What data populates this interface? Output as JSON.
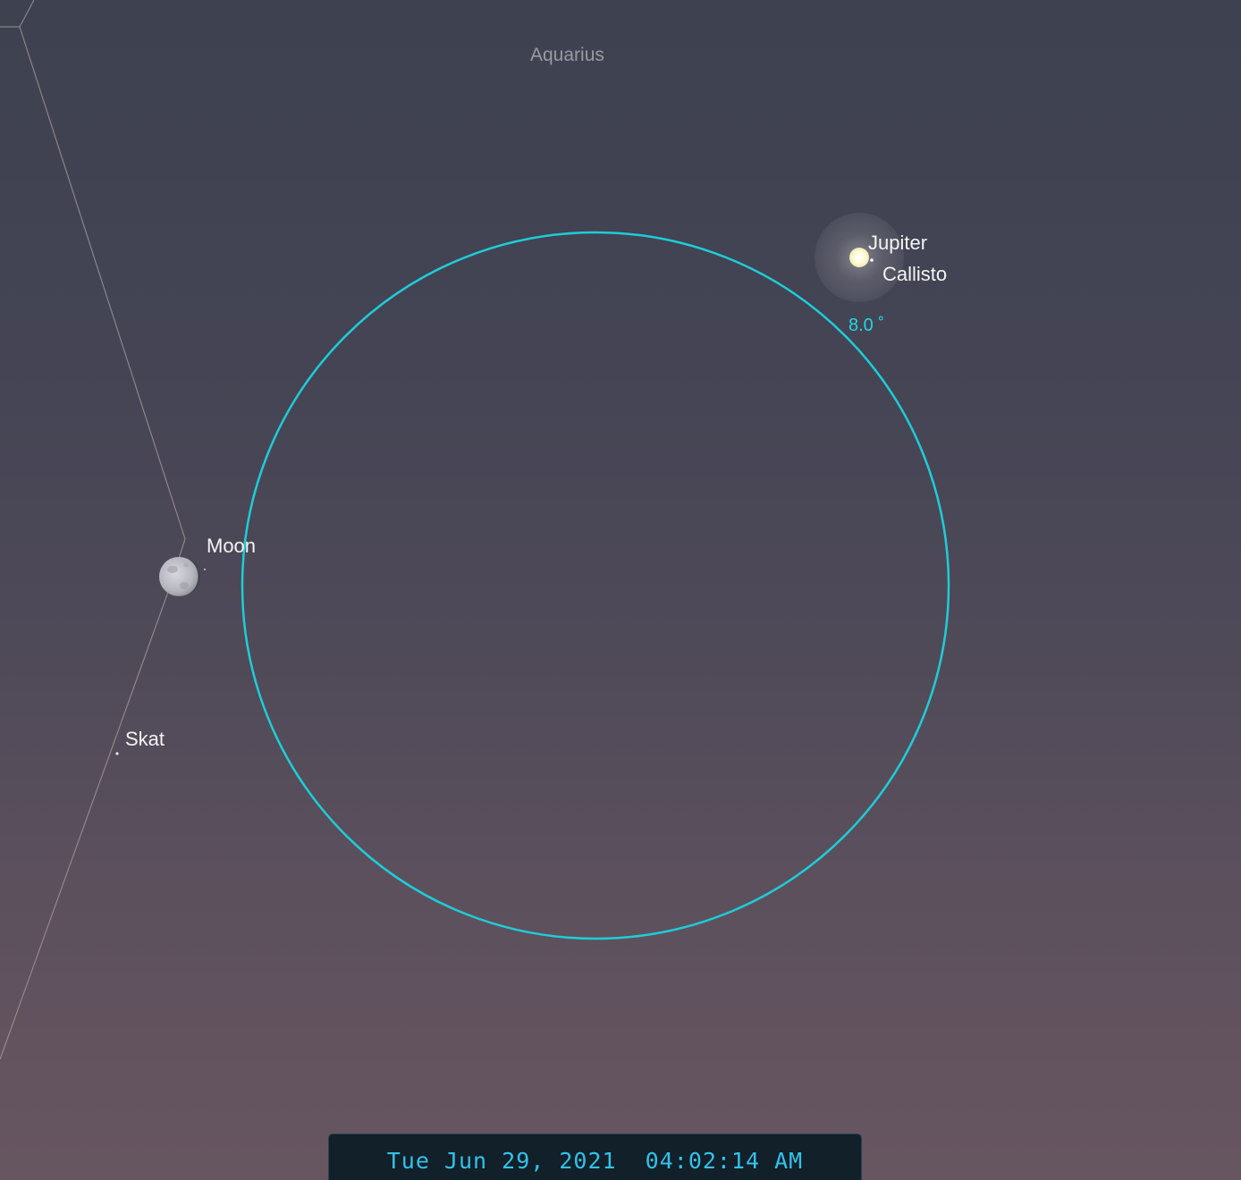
{
  "sky_view": {
    "constellation": "Aquarius",
    "objects": {
      "jupiter": "Jupiter",
      "callisto": "Callisto",
      "moon": "Moon",
      "skat": "Skat"
    },
    "fov_label": "8.0 ˚"
  },
  "time_bar": {
    "datetime": "Tue Jun 29, 2021  04:02:14 AM"
  },
  "colors": {
    "fov_circle": "#1ecdd8",
    "boundary_line": "#a89a98",
    "time_text": "#33c2ea"
  }
}
